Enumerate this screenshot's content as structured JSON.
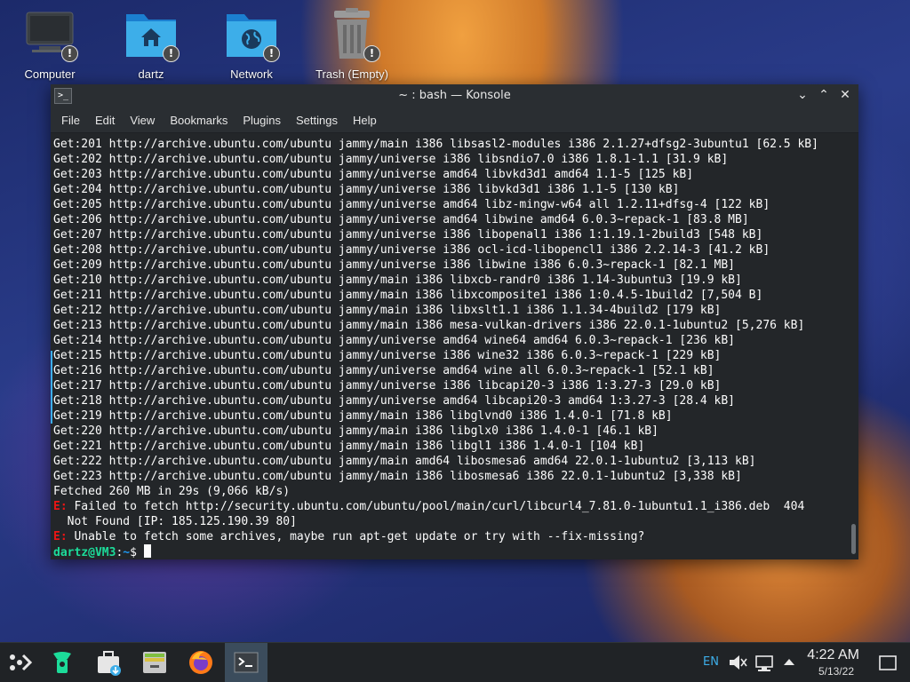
{
  "desktop": {
    "icons": [
      {
        "label": "Computer",
        "icon": "computer-icon"
      },
      {
        "label": "dartz",
        "icon": "home-folder-icon"
      },
      {
        "label": "Network",
        "icon": "network-folder-icon"
      },
      {
        "label": "Trash (Empty)",
        "icon": "trash-icon"
      }
    ],
    "warning_badge": "!"
  },
  "window": {
    "icon_glyph": ">_",
    "title": "~ : bash — Konsole",
    "controls": {
      "minimize": "⌄",
      "maximize": "⌃",
      "close": "✕"
    },
    "menu": [
      "File",
      "Edit",
      "View",
      "Bookmarks",
      "Plugins",
      "Settings",
      "Help"
    ]
  },
  "terminal": {
    "lines": [
      "Get:201 http://archive.ubuntu.com/ubuntu jammy/main i386 libsasl2-modules i386 2.1.27+dfsg2-3ubuntu1 [62.5 kB]",
      "Get:202 http://archive.ubuntu.com/ubuntu jammy/universe i386 libsndio7.0 i386 1.8.1-1.1 [31.9 kB]",
      "Get:203 http://archive.ubuntu.com/ubuntu jammy/universe amd64 libvkd3d1 amd64 1.1-5 [125 kB]",
      "Get:204 http://archive.ubuntu.com/ubuntu jammy/universe i386 libvkd3d1 i386 1.1-5 [130 kB]",
      "Get:205 http://archive.ubuntu.com/ubuntu jammy/universe amd64 libz-mingw-w64 all 1.2.11+dfsg-4 [122 kB]",
      "Get:206 http://archive.ubuntu.com/ubuntu jammy/universe amd64 libwine amd64 6.0.3~repack-1 [83.8 MB]",
      "Get:207 http://archive.ubuntu.com/ubuntu jammy/universe i386 libopenal1 i386 1:1.19.1-2build3 [548 kB]",
      "Get:208 http://archive.ubuntu.com/ubuntu jammy/universe i386 ocl-icd-libopencl1 i386 2.2.14-3 [41.2 kB]",
      "Get:209 http://archive.ubuntu.com/ubuntu jammy/universe i386 libwine i386 6.0.3~repack-1 [82.1 MB]",
      "Get:210 http://archive.ubuntu.com/ubuntu jammy/main i386 libxcb-randr0 i386 1.14-3ubuntu3 [19.9 kB]",
      "Get:211 http://archive.ubuntu.com/ubuntu jammy/main i386 libxcomposite1 i386 1:0.4.5-1build2 [7,504 B]",
      "Get:212 http://archive.ubuntu.com/ubuntu jammy/main i386 libxslt1.1 i386 1.1.34-4build2 [179 kB]",
      "Get:213 http://archive.ubuntu.com/ubuntu jammy/main i386 mesa-vulkan-drivers i386 22.0.1-1ubuntu2 [5,276 kB]",
      "Get:214 http://archive.ubuntu.com/ubuntu jammy/universe amd64 wine64 amd64 6.0.3~repack-1 [236 kB]",
      "Get:215 http://archive.ubuntu.com/ubuntu jammy/universe i386 wine32 i386 6.0.3~repack-1 [229 kB]",
      "Get:216 http://archive.ubuntu.com/ubuntu jammy/universe amd64 wine all 6.0.3~repack-1 [52.1 kB]",
      "Get:217 http://archive.ubuntu.com/ubuntu jammy/universe i386 libcapi20-3 i386 1:3.27-3 [29.0 kB]",
      "Get:218 http://archive.ubuntu.com/ubuntu jammy/universe amd64 libcapi20-3 amd64 1:3.27-3 [28.4 kB]",
      "Get:219 http://archive.ubuntu.com/ubuntu jammy/main i386 libglvnd0 i386 1.4.0-1 [71.8 kB]",
      "Get:220 http://archive.ubuntu.com/ubuntu jammy/main i386 libglx0 i386 1.4.0-1 [46.1 kB]",
      "Get:221 http://archive.ubuntu.com/ubuntu jammy/main i386 libgl1 i386 1.4.0-1 [104 kB]",
      "Get:222 http://archive.ubuntu.com/ubuntu jammy/main amd64 libosmesa6 amd64 22.0.1-1ubuntu2 [3,113 kB]",
      "Get:223 http://archive.ubuntu.com/ubuntu jammy/main i386 libosmesa6 i386 22.0.1-1ubuntu2 [3,338 kB]",
      "Fetched 260 MB in 29s (9,066 kB/s)"
    ],
    "error1_tag": "E:",
    "error1_text": " Failed to fetch http://security.ubuntu.com/ubuntu/pool/main/curl/libcurl4_7.81.0-1ubuntu1.1_i386.deb  404",
    "error1_cont": "  Not Found [IP: 185.125.190.39 80]",
    "error2_tag": "E:",
    "error2_text": " Unable to fetch some archives, maybe run apt-get update or try with --fix-missing?",
    "prompt_user": "dartz@VM3",
    "prompt_sep": ":",
    "prompt_path": "~",
    "prompt_end": "$ "
  },
  "taskbar": {
    "apps": [
      "application-launcher-icon",
      "discover-icon",
      "store-icon",
      "file-manager-icon",
      "firefox-icon",
      "konsole-icon"
    ],
    "tray": {
      "keyboard_layout": "EN",
      "time": "4:22 AM",
      "date": "5/13/22"
    }
  },
  "colors": {
    "terminal_bg": "#232629",
    "prompt_green": "#1cdc9a",
    "prompt_blue": "#1d99f3",
    "error_red": "#ed1515",
    "accent": "#3daee9"
  }
}
